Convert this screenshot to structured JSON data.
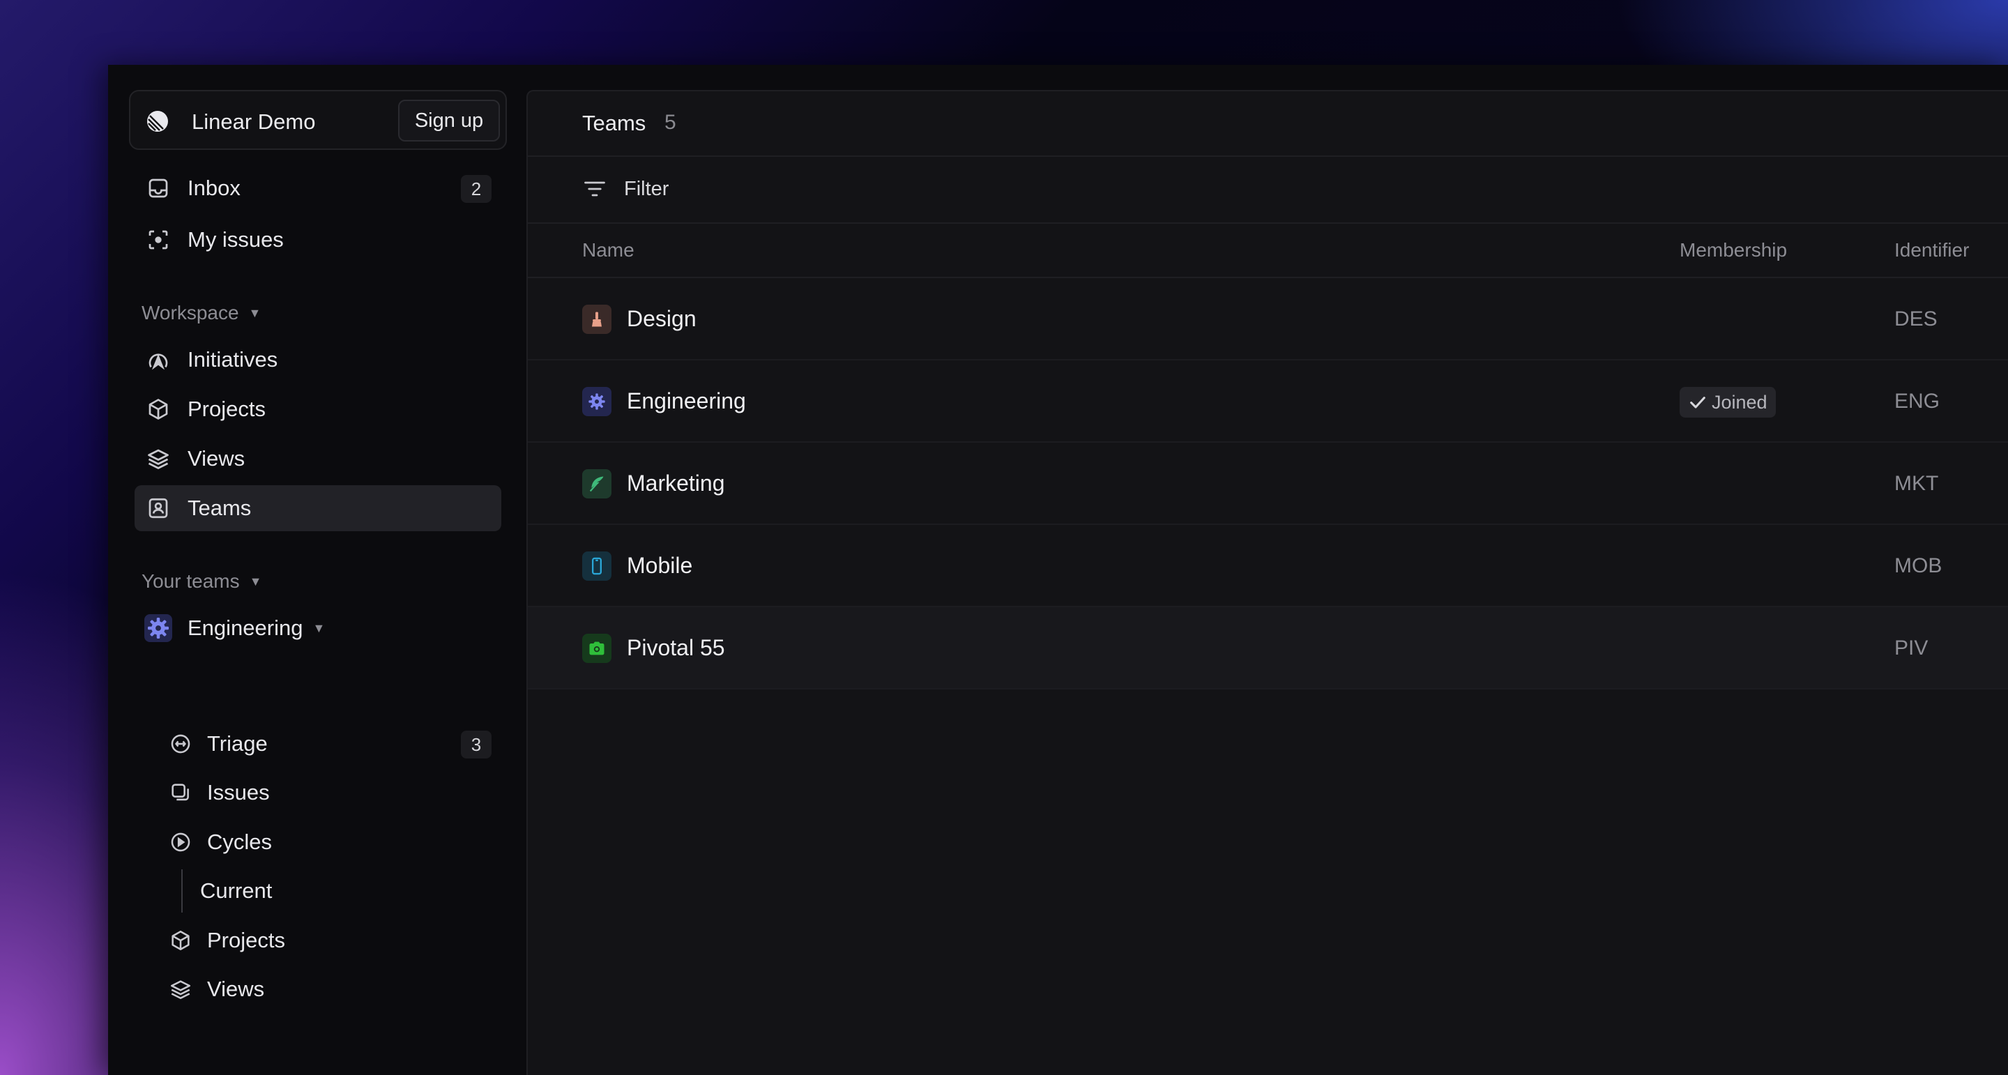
{
  "workspace": {
    "name": "Linear Demo",
    "signup_label": "Sign up"
  },
  "nav": {
    "inbox": {
      "label": "Inbox",
      "count": "2"
    },
    "my_issues": {
      "label": "My issues"
    }
  },
  "workspace_section": {
    "heading": "Workspace",
    "items": [
      {
        "label": "Initiatives",
        "icon": "initiatives-icon"
      },
      {
        "label": "Projects",
        "icon": "projects-icon"
      },
      {
        "label": "Views",
        "icon": "views-icon"
      },
      {
        "label": "Teams",
        "icon": "teams-icon",
        "active": true
      }
    ]
  },
  "your_teams": {
    "heading": "Your teams",
    "team": {
      "label": "Engineering"
    },
    "items": [
      {
        "label": "Triage",
        "count": "3"
      },
      {
        "label": "Issues"
      },
      {
        "label": "Cycles"
      },
      {
        "label": "Current"
      },
      {
        "label": "Projects"
      },
      {
        "label": "Views"
      }
    ]
  },
  "main": {
    "title": "Teams",
    "count": "5",
    "filter_label": "Filter",
    "columns": {
      "name": "Name",
      "membership": "Membership",
      "identifier": "Identifier"
    },
    "rows": [
      {
        "name": "Design",
        "identifier": "DES",
        "membership": "",
        "icon": "brush-icon",
        "color": "#e8a08a"
      },
      {
        "name": "Engineering",
        "identifier": "ENG",
        "membership": "Joined",
        "icon": "gear-icon",
        "color": "#6e79e8"
      },
      {
        "name": "Marketing",
        "identifier": "MKT",
        "membership": "",
        "icon": "feather-icon",
        "color": "#3fb97a"
      },
      {
        "name": "Mobile",
        "identifier": "MOB",
        "membership": "",
        "icon": "phone-icon",
        "color": "#2aa6d6"
      },
      {
        "name": "Pivotal 55",
        "identifier": "PIV",
        "membership": "",
        "icon": "camera-icon",
        "color": "#2fbf3a"
      }
    ]
  }
}
